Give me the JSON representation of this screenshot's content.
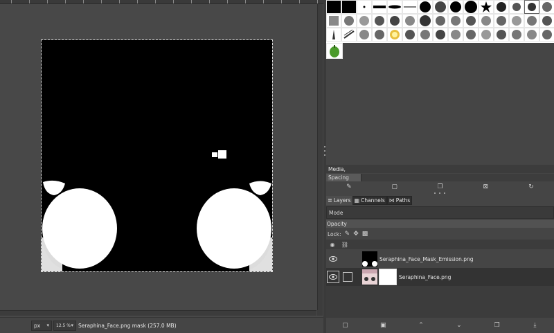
{
  "statusbar": {
    "unit": "px",
    "zoom": "12.5 %",
    "message": "Seraphina_Face.png mask (257.0 MB)"
  },
  "brushes": {
    "selected_name": "Media,",
    "spacing_label": "Spacing"
  },
  "dock_tabs": {
    "layers": "Layers",
    "channels": "Channels",
    "paths": "Paths"
  },
  "layers_panel": {
    "mode_label": "Mode",
    "opacity_label": "Opacity",
    "lock_label": "Lock:"
  },
  "layers": [
    {
      "name": "Seraphina_Face_Mask_Emission.png",
      "visible": true
    },
    {
      "name": "Seraphina_Face.png",
      "visible": true,
      "selected": true
    }
  ],
  "colors": {
    "canvas_bg": "#484848",
    "panel_bg": "#454545",
    "image_bg": "#000000",
    "mask_white": "#ffffff",
    "selected_row": "#333333"
  },
  "icons": {
    "brush_actions": [
      "edit-brush-icon",
      "new-brush-icon",
      "duplicate-brush-icon",
      "delete-brush-icon",
      "refresh-brushes-icon"
    ],
    "layer_actions": [
      "new-layer-icon",
      "new-layer-group-icon",
      "raise-layer-icon",
      "lower-layer-icon",
      "duplicate-layer-icon",
      "merge-down-icon"
    ],
    "lock": [
      "lock-pixels-icon",
      "lock-position-icon",
      "lock-alpha-icon"
    ]
  }
}
